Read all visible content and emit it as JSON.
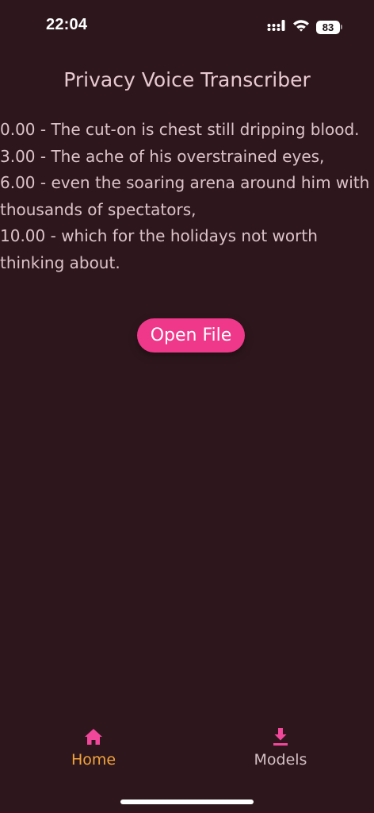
{
  "status_bar": {
    "time": "22:04",
    "battery": "83",
    "icons": [
      "signal-icon",
      "wifi-icon",
      "battery-icon"
    ]
  },
  "app": {
    "title": "Privacy Voice Transcriber"
  },
  "transcript": {
    "lines": [
      "0.00 - The cut-on is chest still dripping blood.",
      "3.00 - The ache of his overstrained eyes,",
      "6.00 - even the soaring arena around him with thousands of spectators,",
      "10.00 - which for the holidays not worth thinking about."
    ]
  },
  "actions": {
    "open_file_label": "Open File"
  },
  "bottom_nav": {
    "items": [
      {
        "label": "Home",
        "icon": "home-icon",
        "active": true
      },
      {
        "label": "Models",
        "icon": "download-icon",
        "active": false
      }
    ]
  },
  "colors": {
    "background": "#2d171d",
    "accent_pink": "#f0388a",
    "active_nav": "#f3a33c",
    "icon_pink": "#f0479a",
    "text": "#dcc3c9"
  }
}
